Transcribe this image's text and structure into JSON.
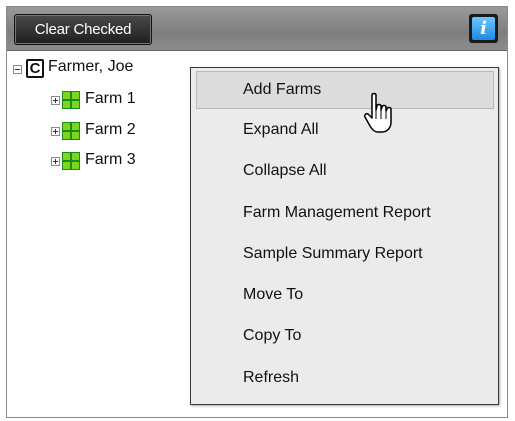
{
  "toolbar": {
    "clear_checked_label": "Clear Checked",
    "info_icon_glyph": "i"
  },
  "tree": {
    "root": {
      "icon_letter": "C",
      "label": "Farmer, Joe"
    },
    "farms": [
      {
        "label": "Farm 1"
      },
      {
        "label": "Farm 2"
      },
      {
        "label": "Farm 3"
      }
    ]
  },
  "context_menu": {
    "items": [
      {
        "label": "Add Farms"
      },
      {
        "label": "Expand All"
      },
      {
        "label": "Collapse All"
      },
      {
        "label": "Farm Management Report"
      },
      {
        "label": "Sample Summary Report"
      },
      {
        "label": "Move To"
      },
      {
        "label": "Copy To"
      },
      {
        "label": "Refresh"
      }
    ],
    "hovered_item": "Add Farms"
  },
  "colors": {
    "toolbar_bg": "#8c8c8c",
    "farm_icon_dark": "#1a8a1a",
    "farm_icon_light": "#7cd61c",
    "info_icon": "#1e88e5",
    "menu_bg": "#ebebeb"
  }
}
